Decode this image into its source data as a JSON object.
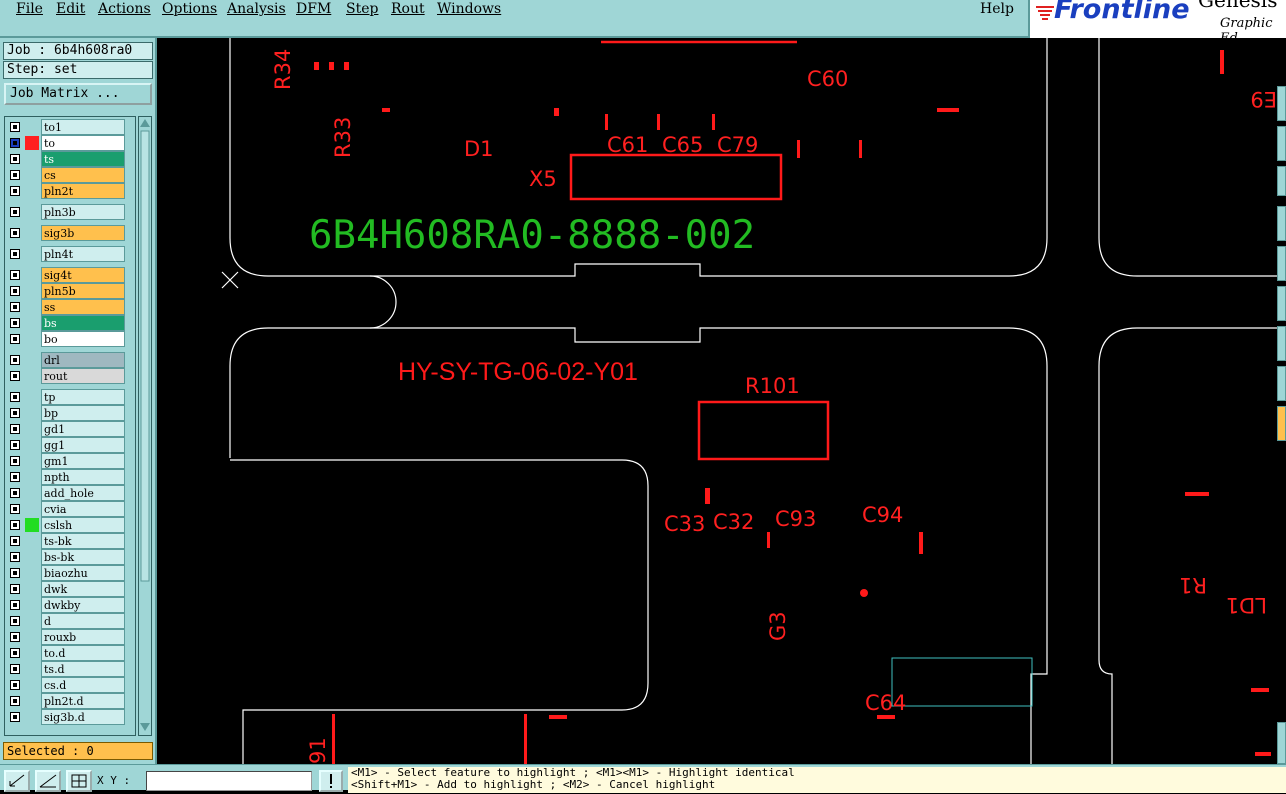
{
  "menu": [
    "File",
    "Edit",
    "Actions",
    "Options",
    "Analysis",
    "DFM",
    "Step",
    "Rout",
    "Windows"
  ],
  "help": "Help",
  "brand": {
    "name": "Frontline",
    "product": "Genesis",
    "tagline": "Graphic Ed"
  },
  "job_label": "Job : 6b4h608ra0",
  "step_label": "Step: set",
  "job_matrix_label": "Job Matrix ...",
  "layers": [
    {
      "name": "to1",
      "color": "#cfeeee"
    },
    {
      "name": "to",
      "color": "#ffffff",
      "swatch": "#ff2020"
    },
    {
      "name": "ts",
      "color": "#1a9e6e"
    },
    {
      "name": "cs",
      "color": "#ffc04d"
    },
    {
      "name": "pln2t",
      "color": "#ffc04d"
    },
    {
      "name": "pln3b",
      "color": "#cfeeee"
    },
    {
      "name": "sig3b",
      "color": "#ffc04d"
    },
    {
      "name": "pln4t",
      "color": "#cfeeee"
    },
    {
      "name": "sig4t",
      "color": "#ffc04d"
    },
    {
      "name": "pln5b",
      "color": "#ffc04d"
    },
    {
      "name": "ss",
      "color": "#ffc04d"
    },
    {
      "name": "bs",
      "color": "#1a9e6e"
    },
    {
      "name": "bo",
      "color": "#ffffff"
    },
    {
      "name": "drl",
      "color": "#9fb8c0"
    },
    {
      "name": "rout",
      "color": "#d9d9d9"
    },
    {
      "name": "tp",
      "color": "#cfeeee"
    },
    {
      "name": "bp",
      "color": "#cfeeee"
    },
    {
      "name": "gd1",
      "color": "#cfeeee"
    },
    {
      "name": "gg1",
      "color": "#cfeeee"
    },
    {
      "name": "gm1",
      "color": "#cfeeee"
    },
    {
      "name": "npth",
      "color": "#cfeeee"
    },
    {
      "name": "add_hole",
      "color": "#cfeeee"
    },
    {
      "name": "cvia",
      "color": "#cfeeee"
    },
    {
      "name": "cslsh",
      "color": "#cfeeee",
      "swatch": "#22dd22"
    },
    {
      "name": "ts-bk",
      "color": "#cfeeee"
    },
    {
      "name": "bs-bk",
      "color": "#cfeeee"
    },
    {
      "name": "biaozhu",
      "color": "#cfeeee"
    },
    {
      "name": "dwk",
      "color": "#cfeeee"
    },
    {
      "name": "dwkby",
      "color": "#cfeeee"
    },
    {
      "name": "d",
      "color": "#cfeeee"
    },
    {
      "name": "rouxb",
      "color": "#cfeeee"
    },
    {
      "name": "to.d",
      "color": "#cfeeee"
    },
    {
      "name": "ts.d",
      "color": "#cfeeee"
    },
    {
      "name": "cs.d",
      "color": "#cfeeee"
    },
    {
      "name": "pln2t.d",
      "color": "#cfeeee"
    },
    {
      "name": "sig3b.d",
      "color": "#cfeeee"
    }
  ],
  "selected_label": "Selected : 0",
  "coord_label": "X Y :",
  "coord_value": "",
  "hint": "<M1> - Select feature to highlight ; <M1><M1> - Highlight identical\n<Shift+M1> - Add to highlight ; <M2> - Cancel highlight",
  "canvas_text": {
    "part_number": "6B4H608RA0-8888-002",
    "board_label": "HY-SY-TG-06-02-Y01",
    "refs": [
      "R34",
      "R33",
      "D1",
      "C61",
      "C65",
      "C79",
      "X5",
      "C60",
      "R101",
      "C33",
      "C32",
      "C93",
      "C94",
      "G3",
      "C64",
      "R1",
      "LD1",
      "E9",
      "91"
    ]
  },
  "colors": {
    "silk_red": "#ff1a1a",
    "silk_green": "#22bb22",
    "outline": "#ffffff",
    "highlight": "#40c0c0"
  }
}
